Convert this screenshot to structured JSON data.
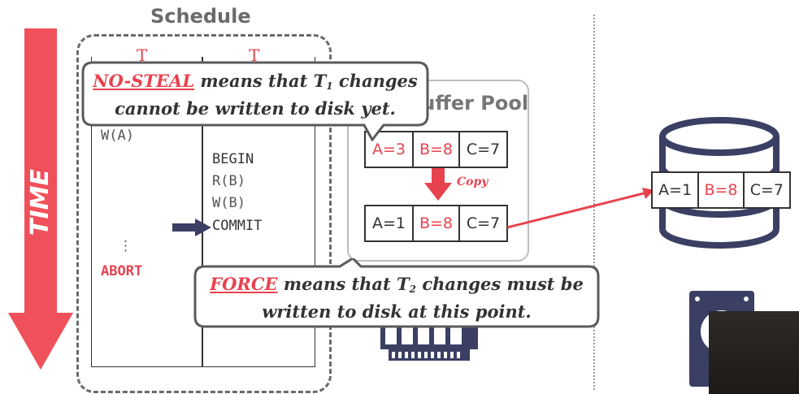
{
  "time_label": "TIME",
  "schedule": {
    "title": "Schedule",
    "t1_header": "T",
    "t2_header": "T",
    "t1_ops": [
      "W(A)",
      "⋮",
      "ABORT"
    ],
    "t2_ops": [
      "BEGIN",
      "R(B)",
      "W(B)",
      "COMMIT"
    ]
  },
  "buffer_pool": {
    "title": "Buffer Pool",
    "top_row": [
      "A=3",
      "B=8",
      "C=7"
    ],
    "copy_label": "Copy",
    "bottom_row": [
      "A=1",
      "B=8",
      "C=7"
    ]
  },
  "disk": {
    "row": [
      "A=1",
      "B=8",
      "C=7"
    ]
  },
  "callouts": {
    "nosteal_term": "NO-STEAL",
    "nosteal_line1_rest": " means that T",
    "nosteal_sub": "1",
    "nosteal_line1_end": " changes",
    "nosteal_line2": "cannot be written to disk yet.",
    "force_term": "FORCE",
    "force_line1_rest": " means that T",
    "force_sub": "2",
    "force_line1_end": " changes must be",
    "force_line2": "written to disk at this point."
  },
  "colors": {
    "accent_red": "#e8424f",
    "text_dark": "#333333",
    "gray": "#6b6b6b",
    "arrow_navy": "#3b3f63"
  }
}
